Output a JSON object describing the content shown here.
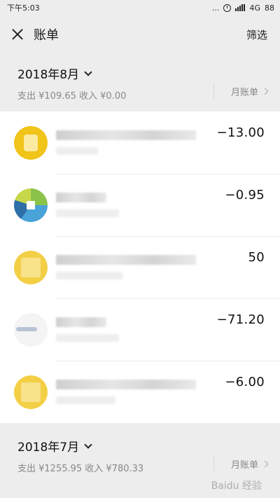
{
  "status_bar": {
    "time": "下午5:03",
    "dots": "...",
    "signal_text": "4G",
    "battery": "88"
  },
  "header": {
    "title": "账单",
    "filter_label": "筛选"
  },
  "months": [
    {
      "label": "2018年8月",
      "summary": "支出 ¥109.65 收入 ¥0.00",
      "monthly_bill_label": "月账单",
      "transactions": [
        {
          "avatar": "yellow-logo",
          "amount": "−13.00"
        },
        {
          "avatar": "multicolor-logo",
          "amount": "−0.95"
        },
        {
          "avatar": "yellow-logo",
          "amount": "50"
        },
        {
          "avatar": "gray-logo",
          "amount": "−71.20"
        },
        {
          "avatar": "yellow-logo",
          "amount": "−6.00"
        }
      ]
    },
    {
      "label": "2018年7月",
      "summary": "支出 ¥1255.95 收入 ¥780.33",
      "monthly_bill_label": "月账单"
    }
  ],
  "watermark": "Baidu 经验",
  "icons": {
    "close": "close-icon",
    "month_dropdown": "chevron-down-icon",
    "monthly_bill_arrow": "chevron-right-icon",
    "alarm": "alarm-icon"
  }
}
